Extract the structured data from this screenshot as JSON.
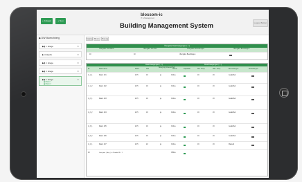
{
  "toolbar": {
    "button1_label": "+ Anlegen",
    "button2_label": "+ Neu",
    "top_right_label": "Logout Button"
  },
  "brand": {
    "logo": "blossom-ic",
    "subtitle": "IT & Management",
    "title": "Building Management System"
  },
  "sidebar": {
    "heading": "◆ DW Muenchberg",
    "items": [
      {
        "label": "▶▮ 1. Etage"
      },
      {
        "label": "▶ Aufgabe"
      },
      {
        "label": "▶▮ 2. Etage"
      },
      {
        "label": "▶▮ 3. Etage"
      },
      {
        "label": "▶▮ 4. Etage",
        "sub1": "▣ Raum 1",
        "sub2": "▣ Raum 2"
      }
    ]
  },
  "tabs": [
    {
      "label": "Katalog"
    },
    {
      "label": "Räume"
    },
    {
      "label": "Planung"
    }
  ],
  "overview": {
    "banner": "Übergabe Raumbelegungen ( 1 )",
    "headers": [
      "Übergabe Von Bisher",
      "Übergabe Von Neu",
      "Übergabe Bemerkungen",
      "Übergabe Beauftragen"
    ],
    "values": [
      "10",
      "10",
      "Übergabe Beauftragen",
      ""
    ]
  },
  "table": {
    "banner_left": "Raumbelegungen ( 1 )",
    "banner_right": "Raumbelegungen ( 1 )",
    "headers": [
      "ID",
      "Raumname",
      "Raum",
      "Soll",
      "Belegung Anwesenheit",
      "Status",
      "Kapazität",
      "Min. Temp.",
      "Max. Temp.",
      "Bemerkungen",
      "Einstellungen"
    ],
    "rows": [
      {
        "id": "1_1_1",
        "name": "Raum 101",
        "raum": "23.5",
        "soll": "19",
        "anw": "ja",
        "status": "Online",
        "min": "19",
        "max": "23",
        "note": "Gerät/Zeit"
      },
      {
        "id": "1_1_2",
        "name": "Raum 102",
        "raum": "23.5",
        "soll": "19",
        "anw": "ja",
        "status": "Online",
        "min": "19",
        "max": "23",
        "note": "Gerät/Zeit"
      },
      {
        "id": "1_2_1",
        "name": "Raum 103",
        "raum": "23.5",
        "soll": "19",
        "anw": "ja",
        "status": "Online",
        "min": "19",
        "max": "23",
        "note": "Gerät/Zeit"
      },
      {
        "id": "1_2_2",
        "name": "Raum 104",
        "raum": "23.5",
        "soll": "19",
        "anw": "ja",
        "status": "Online",
        "min": "19",
        "max": "23",
        "note": "Gerät/Zeit"
      },
      {
        "id": "1_3_1",
        "name": "Raum 105",
        "raum": "23.5",
        "soll": "19",
        "anw": "ja",
        "status": "Online",
        "min": "19",
        "max": "23",
        "note": "Gerät/Zeit"
      },
      {
        "id": "1_3_2",
        "name": "Raum 106",
        "raum": "23.5",
        "soll": "19",
        "anw": "ja",
        "status": "Online",
        "min": "19",
        "max": "23",
        "note": "Gerät/Zeit"
      },
      {
        "id": "1_4_1",
        "name": "Raum 107",
        "raum": "23.5",
        "soll": "22",
        "anw": "ja",
        "status": "Online",
        "min": "19",
        "max": "23",
        "note": "Manuell"
      },
      {
        "id": "10",
        "name": "Leer gem. | Hng. | >> Protokoll ID : 1",
        "raum": "",
        "soll": "",
        "anw": "",
        "status": "Offline",
        "min": "",
        "max": "",
        "note": ""
      }
    ]
  },
  "colors": {
    "accent": "#2e9b54",
    "header": "#2f8f4c",
    "header_light": "#c7e6cc"
  }
}
